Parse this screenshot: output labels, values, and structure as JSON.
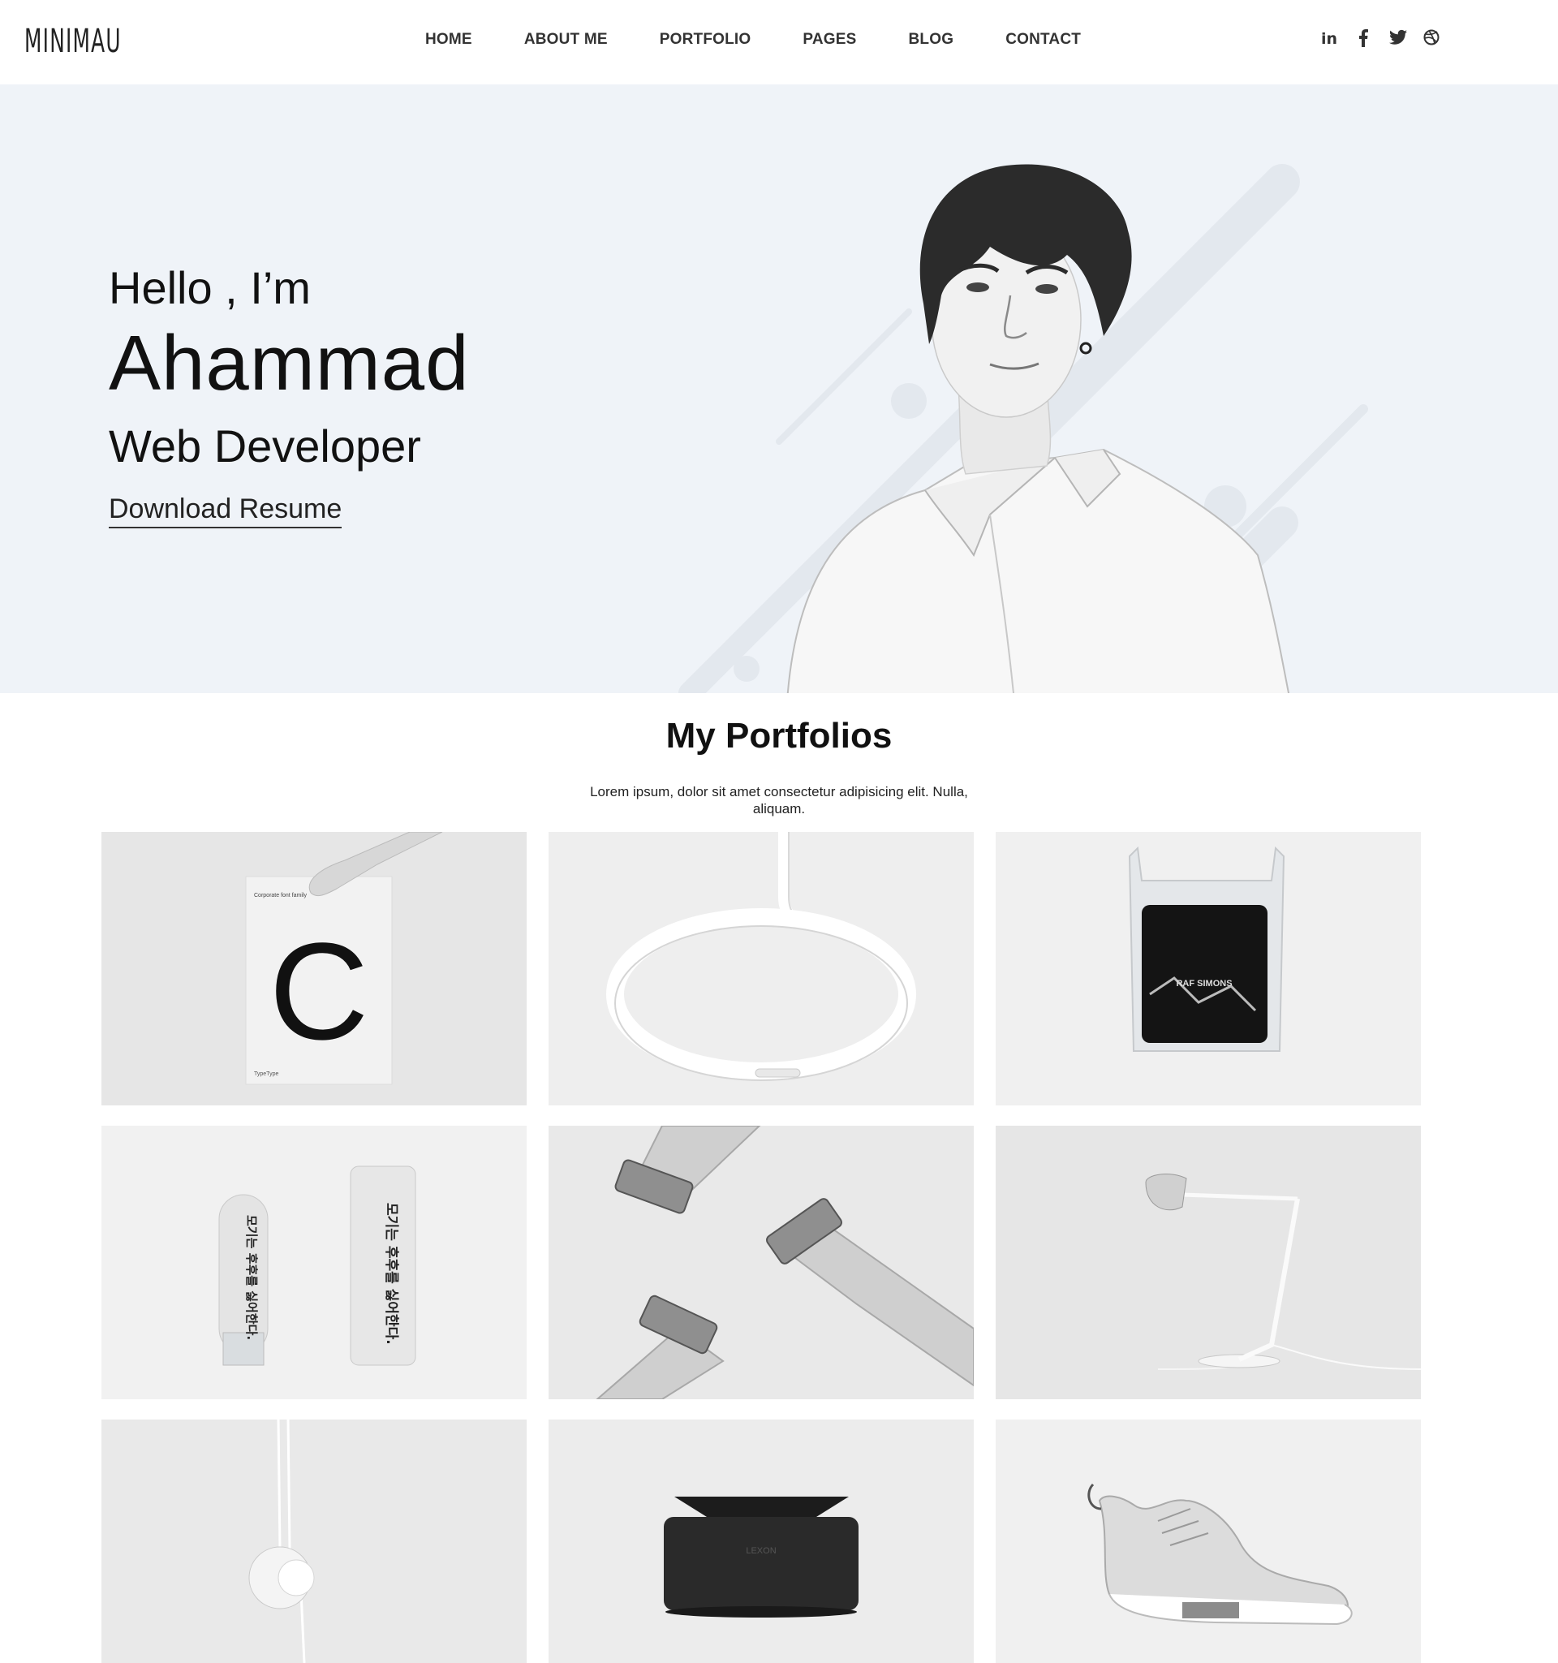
{
  "header": {
    "logo": "MINIMAU",
    "nav": [
      "HOME",
      "ABOUT ME",
      "PORTFOLIO",
      "PAGES",
      "BLOG",
      "CONTACT"
    ],
    "social": [
      {
        "name": "linkedin-icon",
        "glyph": "in"
      },
      {
        "name": "facebook-icon",
        "glyph": "f"
      },
      {
        "name": "twitter-icon",
        "glyph": "🐦"
      },
      {
        "name": "dribbble-icon",
        "glyph": "⊛"
      }
    ]
  },
  "hero": {
    "greeting": "Hello , I’m",
    "name": "Ahammad",
    "role": "Web Developer",
    "cta": "Download Resume"
  },
  "portfolio": {
    "title": "My Portfolios",
    "subtitle": "Lorem ipsum, dolor sit amet consectetur adipisicing elit. Nulla, aliquam.",
    "items": [
      {
        "name": "poster-c",
        "poster_text": "Corporate font family",
        "letter": "C",
        "brand": "TypeType"
      },
      {
        "name": "ring-lamp"
      },
      {
        "name": "bag-product",
        "label": "RAF SIMONS"
      },
      {
        "name": "cosmetics",
        "label": "모기는 후후를 싫어한다."
      },
      {
        "name": "razor-tools"
      },
      {
        "name": "desk-lamp"
      },
      {
        "name": "pendant-lamp"
      },
      {
        "name": "speaker",
        "label": "LEXON"
      },
      {
        "name": "sneaker"
      }
    ]
  },
  "colors": {
    "hero_bg": "#eff3f8",
    "text": "#111111",
    "nav_text": "#333333"
  }
}
